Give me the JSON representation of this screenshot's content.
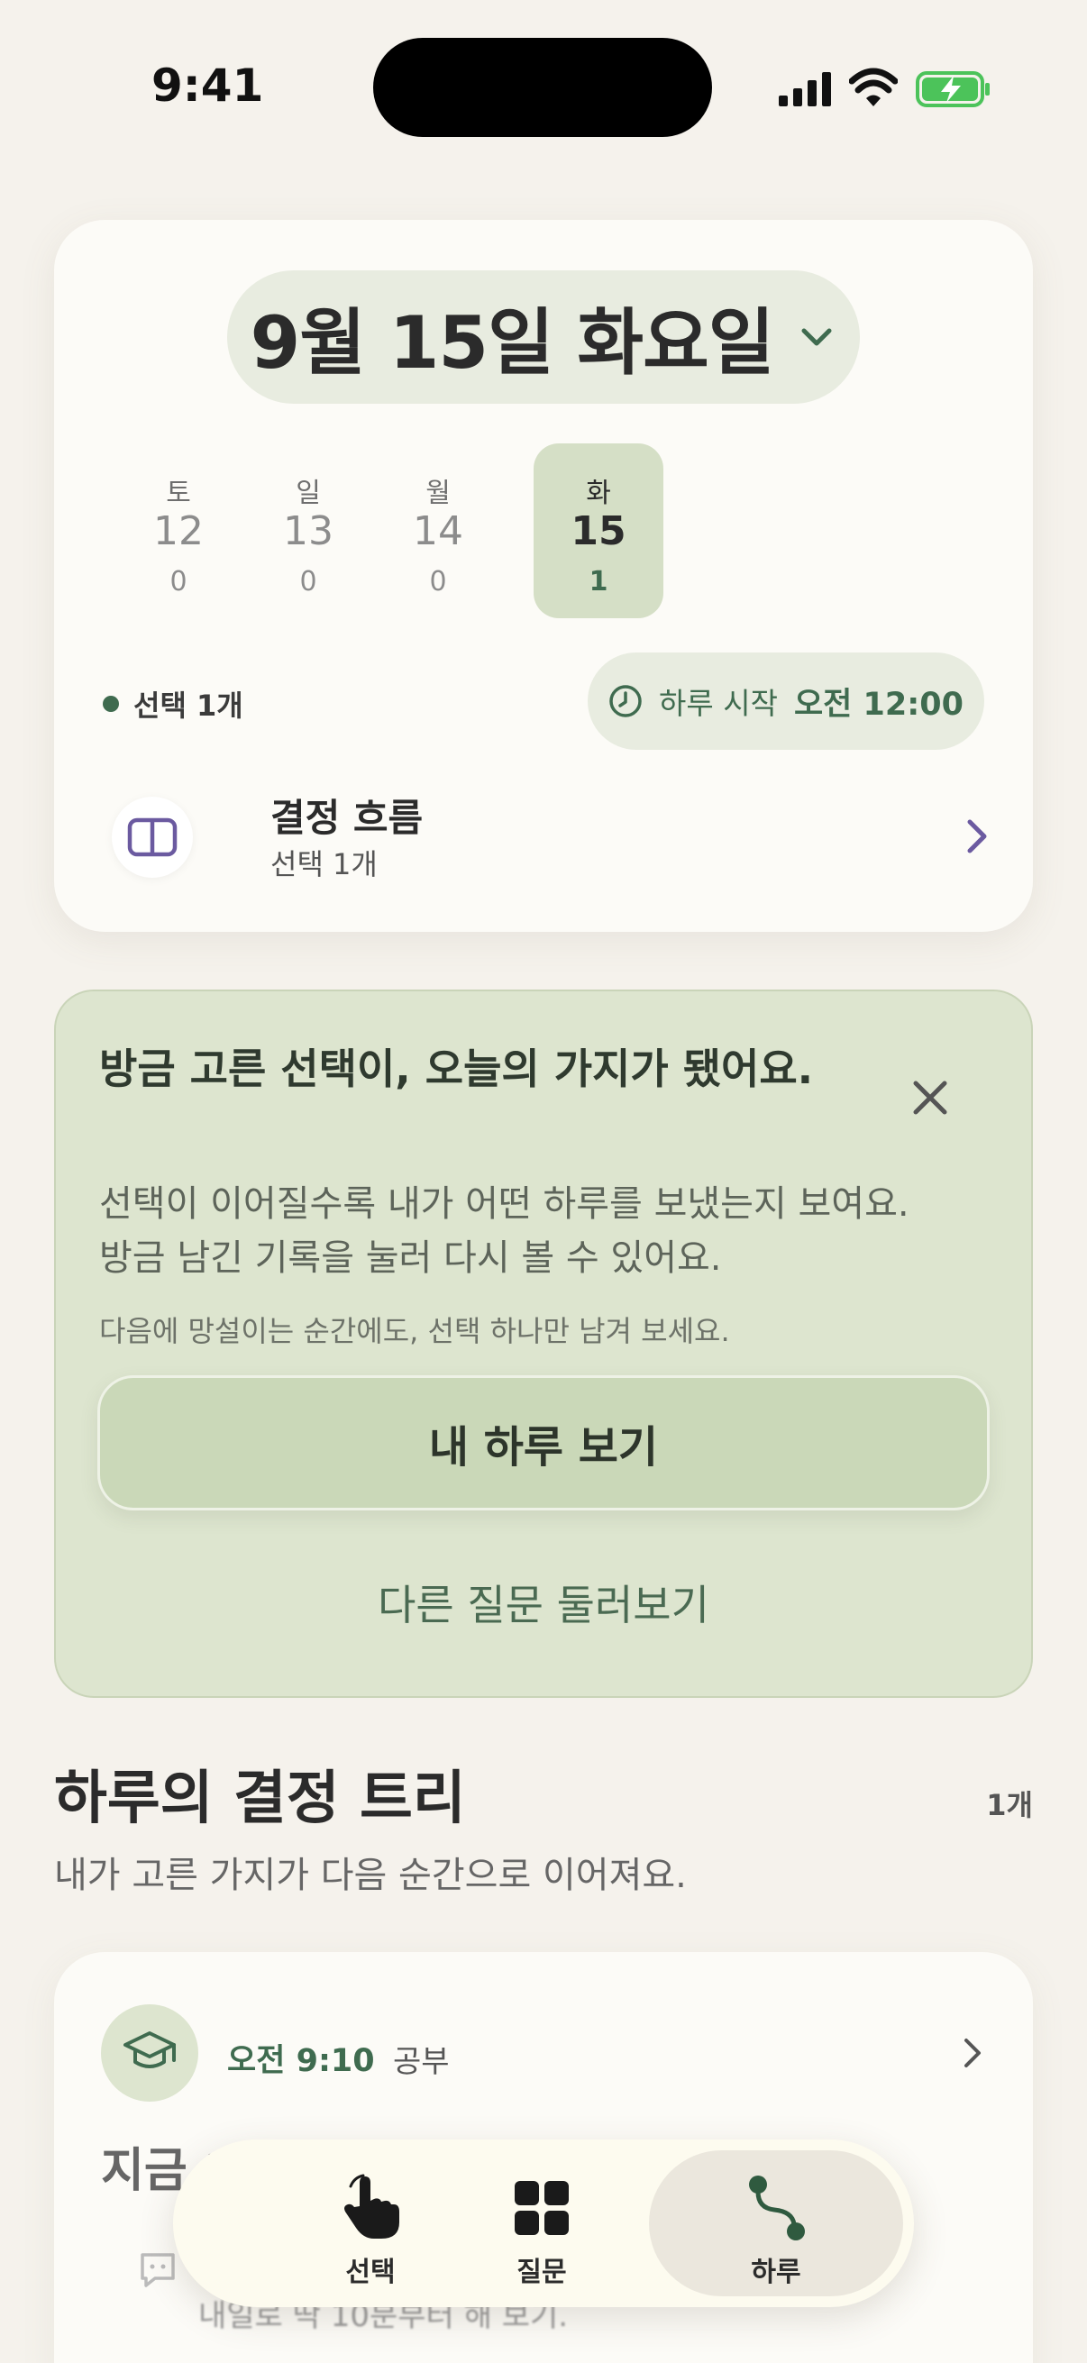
{
  "status_bar": {
    "time": "9:41"
  },
  "date_header": {
    "title": "9월 15일 화요일",
    "week": [
      {
        "name": "토",
        "num": "12",
        "count": "0"
      },
      {
        "name": "일",
        "num": "13",
        "count": "0"
      },
      {
        "name": "월",
        "num": "14",
        "count": "0"
      },
      {
        "name": "화",
        "num": "15",
        "count": "1"
      }
    ],
    "select_count": "선택 1개",
    "day_start_label": "하루 시작",
    "day_start_time": "오전 12:00",
    "flow_title": "결정 흐름",
    "flow_subtitle": "선택 1개"
  },
  "notice": {
    "title": "방금 고른 선택이, 오늘의 가지가 됐어요.",
    "body_line1": "선택이 이어질수록 내가 어떤 하루를 보냈는지 보여요.",
    "body_line2": "방금 남긴 기록을 눌러 다시 볼 수 있어요.",
    "hint": "다음에 망설이는 순간에도, 선택 하나만 남겨 보세요.",
    "primary_label": "내 하루 보기",
    "secondary_label": "다른 질문 둘러보기"
  },
  "tree": {
    "title": "하루의 결정 트리",
    "count": "1개",
    "subtitle": "내가 고른 가지가 다음 순간으로 이어져요.",
    "entry": {
      "time": "오전 9:10",
      "category": "공부",
      "prompt": "지금 1",
      "note": "내일로 딱 10분부터 해 보기."
    }
  },
  "tabs": [
    {
      "label": "선택",
      "icon": "hand-pointer-icon"
    },
    {
      "label": "질문",
      "icon": "grid-icon"
    },
    {
      "label": "하루",
      "icon": "path-icon"
    }
  ],
  "colors": {
    "accent_green": "#3f6b4f",
    "notice_bg": "#dde5cf",
    "purple_icon": "#6b5aa0"
  }
}
